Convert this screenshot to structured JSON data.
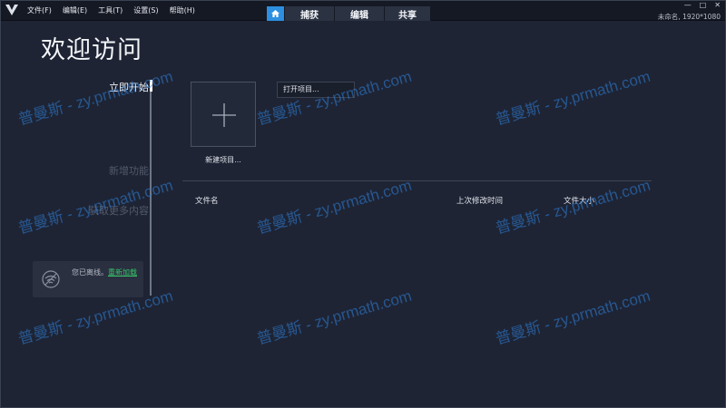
{
  "menu": [
    "文件(F)",
    "编辑(E)",
    "工具(T)",
    "设置(S)",
    "帮助(H)"
  ],
  "tabs": {
    "capture": "捕获",
    "edit": "编辑",
    "share": "共享"
  },
  "window_controls": {
    "minimize": "—",
    "maximize": "□",
    "close": "✕"
  },
  "project_info": "未命名, 1920*1080",
  "welcome": {
    "title": "欢迎访问"
  },
  "nav": {
    "start_now": "立即开始",
    "new_features": "新增功能",
    "more_content": "获取更多内容"
  },
  "offline": {
    "message": "您已离线。",
    "reload": "重新加载"
  },
  "main": {
    "new_project": "新建项目...",
    "open_project": "打开项目...",
    "columns": {
      "filename": "文件名",
      "modified": "上次修改时间",
      "size": "文件大小"
    }
  },
  "watermark": "普曼斯 - zy.prmath.com",
  "colors": {
    "accent": "#2d8fe0",
    "background": "#1e2434",
    "link": "#39c26a"
  }
}
